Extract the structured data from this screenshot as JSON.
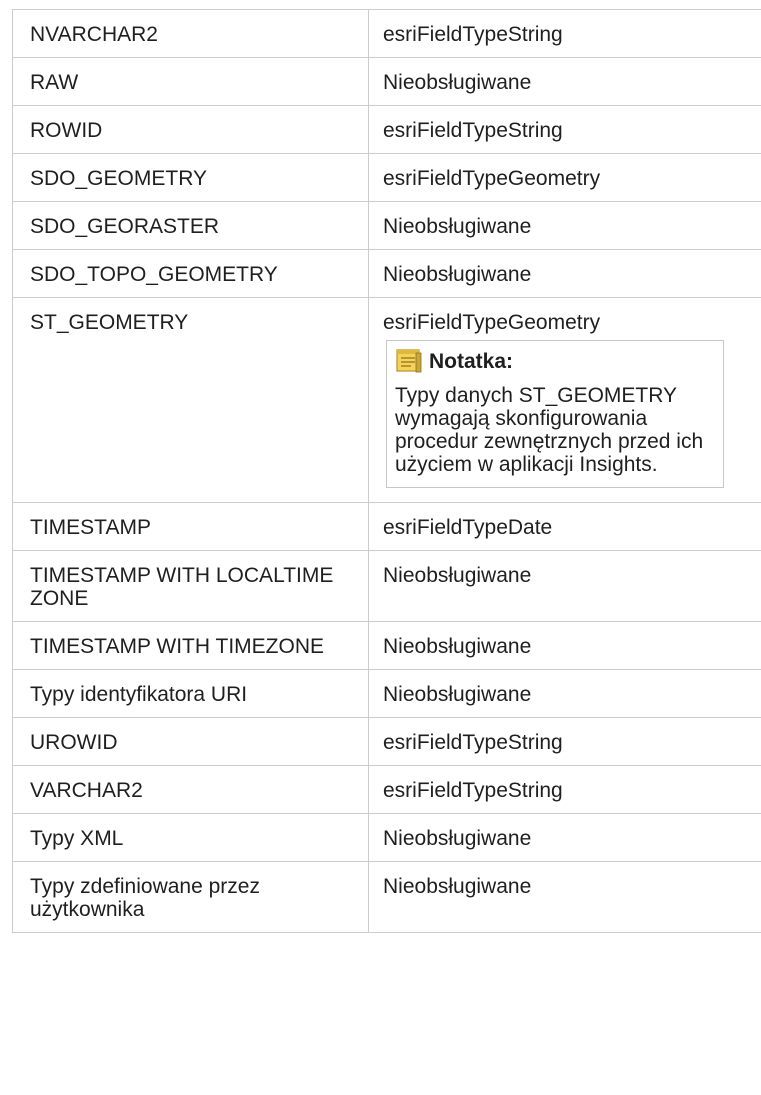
{
  "rows": [
    {
      "type": "NVARCHAR2",
      "mapping": "esriFieldTypeString"
    },
    {
      "type": "RAW",
      "mapping": "Nieobsługiwane"
    },
    {
      "type": "ROWID",
      "mapping": "esriFieldTypeString"
    },
    {
      "type": "SDO_GEOMETRY",
      "mapping": "esriFieldTypeGeometry"
    },
    {
      "type": "SDO_GEORASTER",
      "mapping": "Nieobsługiwane"
    },
    {
      "type": "SDO_TOPO_GEOMETRY",
      "mapping": "Nieobsługiwane"
    },
    {
      "type": "ST_GEOMETRY",
      "mapping": "esriFieldTypeGeometry"
    },
    {
      "type": "TIMESTAMP",
      "mapping": "esriFieldTypeDate"
    },
    {
      "type": "TIMESTAMP WITH LOCALTIME ZONE",
      "mapping": "Nieobsługiwane"
    },
    {
      "type": "TIMESTAMP WITH TIMEZONE",
      "mapping": "Nieobsługiwane"
    },
    {
      "type": "Typy identyfikatora URI",
      "mapping": "Nieobsługiwane"
    },
    {
      "type": "UROWID",
      "mapping": "esriFieldTypeString"
    },
    {
      "type": "VARCHAR2",
      "mapping": "esriFieldTypeString"
    },
    {
      "type": "Typy XML",
      "mapping": "Nieobsługiwane"
    },
    {
      "type": "Typy zdefiniowane przez użytkownika",
      "mapping": "Nieobsługiwane"
    }
  ],
  "note": {
    "title": "Notatka:",
    "icon": "note-icon",
    "body": "Typy danych ST_GEOMETRY wymagają skonfigurowania procedur zewnętrznych przed ich użyciem w aplikacji Insights."
  },
  "colors": {
    "border": "#cccccc",
    "text": "#1f1f1f",
    "note_icon": "#e8c23a"
  }
}
